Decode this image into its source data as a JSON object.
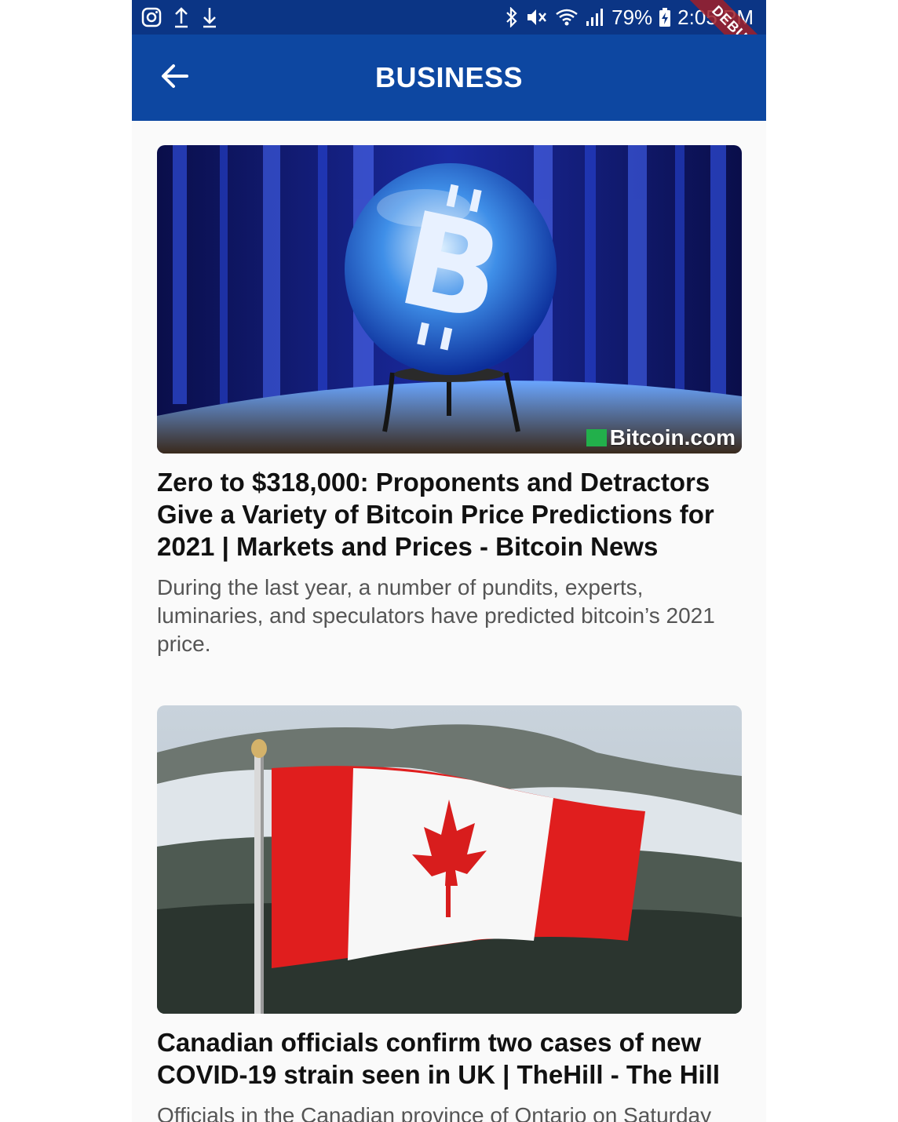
{
  "status_bar": {
    "icons_left": [
      "instagram-icon",
      "upload-icon",
      "download-icon"
    ],
    "icons_right": [
      "bluetooth-icon",
      "mute-icon",
      "wifi-icon",
      "signal-icon"
    ],
    "battery_percent": "79%",
    "time": "2:05 PM",
    "debug_banner": "DEBUG",
    "background_color": "#0b3585"
  },
  "app_bar": {
    "title": "BUSINESS",
    "back_icon": "arrow-left-icon",
    "background_color": "#0d47a1"
  },
  "articles": [
    {
      "title": "Zero to $318,000: Proponents and Detractors Give a Variety of Bitcoin Price Predictions for 2021 | Markets and Prices - Bitcoin News",
      "description": "During the last year, a number of pundits, experts, luminaries, and speculators have predicted bitcoin’s 2021 price.",
      "image_alt": "Bitcoin logo inside crystal ball",
      "image_watermark": "Bitcoin.com"
    },
    {
      "title": "Canadian officials confirm two cases of new COVID-19 strain seen in UK | TheHill - The Hill",
      "description": "Officials in the Canadian province of Ontario on Saturday",
      "image_alt": "Canadian flag waving in front of snowy mountain"
    }
  ]
}
